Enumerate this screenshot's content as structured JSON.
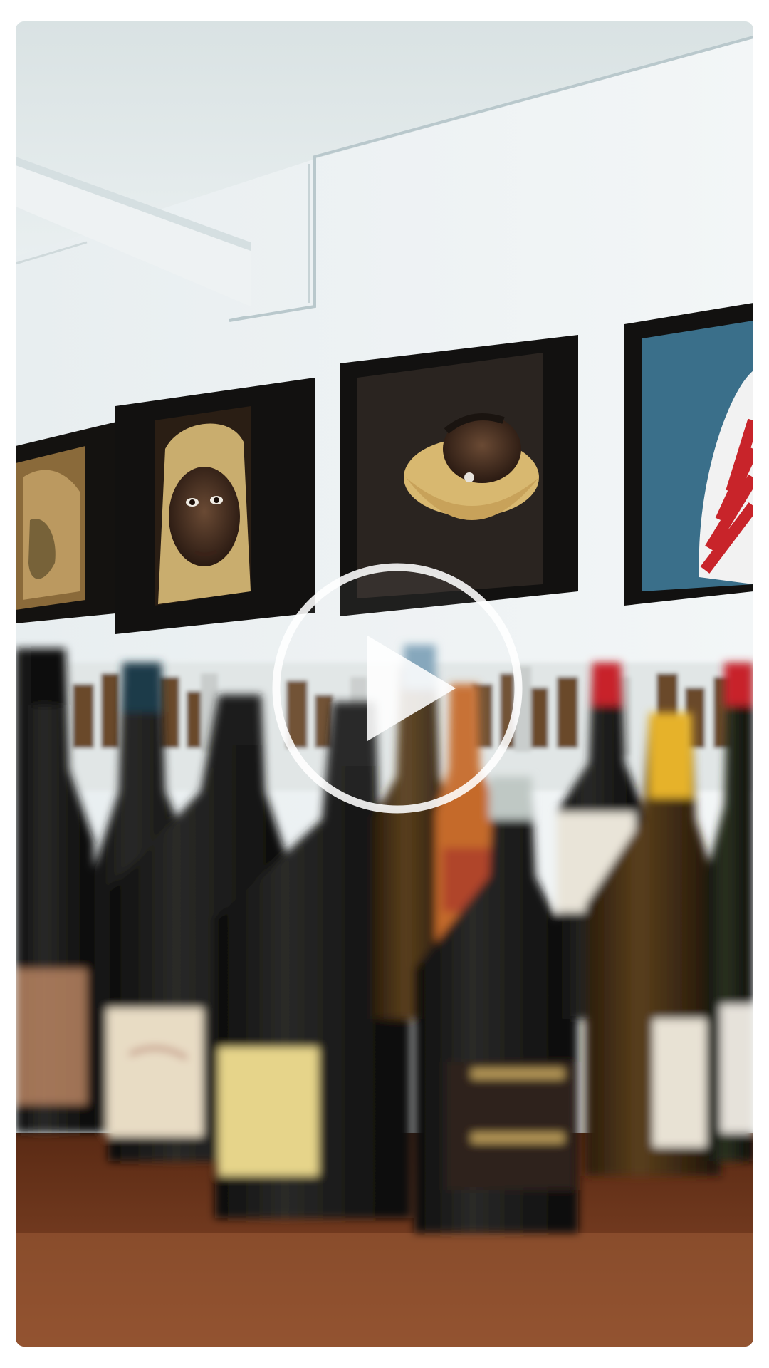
{
  "video": {
    "state": "paused",
    "play_icon": "play-circle-icon"
  }
}
